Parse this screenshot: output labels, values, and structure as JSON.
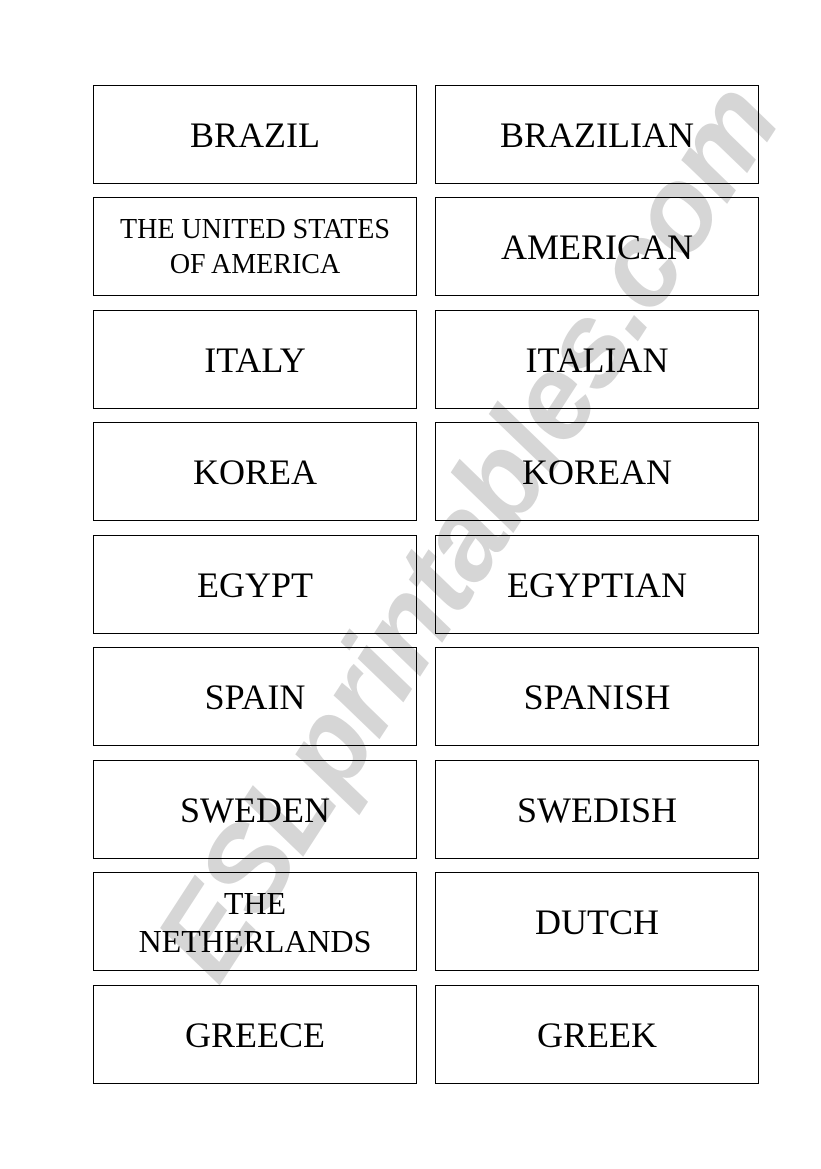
{
  "watermark": "ESLprintables.com",
  "cards": [
    {
      "country": "BRAZIL",
      "nationality": "BRAZILIAN"
    },
    {
      "country": "THE UNITED STATES OF AMERICA",
      "nationality": "AMERICAN"
    },
    {
      "country": "ITALY",
      "nationality": "ITALIAN"
    },
    {
      "country": "KOREA",
      "nationality": "KOREAN"
    },
    {
      "country": "EGYPT",
      "nationality": "EGYPTIAN"
    },
    {
      "country": "SPAIN",
      "nationality": "SPANISH"
    },
    {
      "country": "SWEDEN",
      "nationality": "SWEDISH"
    },
    {
      "country": "THE NETHERLANDS",
      "nationality": "DUTCH"
    },
    {
      "country": "GREECE",
      "nationality": "GREEK"
    }
  ]
}
